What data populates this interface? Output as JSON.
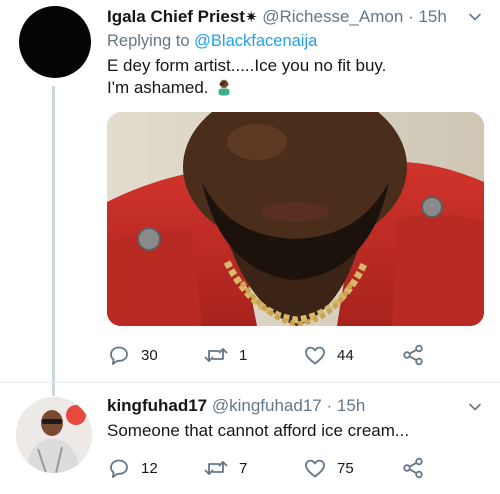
{
  "tweets": [
    {
      "name": "Igala Chief Priest",
      "name_symbol": "✷",
      "handle": "@Richesse_Amon",
      "separator": "·",
      "time": "15h",
      "replying_prefix": "Replying to",
      "replying_to": "@Blackfacenaija",
      "text_line_1": "E dey form artist.....Ice you no fit buy.",
      "text_line_2": "I'm ashamed.",
      "emoji_icon": "man-facepalming-icon",
      "media": "photo of a man in a red jacket with gold chain",
      "replies": "30",
      "retweets": "1",
      "likes": "44"
    },
    {
      "name": "kingfuhad17",
      "handle": "@kingfuhad17",
      "separator": "·",
      "time": "15h",
      "text": "Someone that cannot afford ice cream...",
      "replies": "12",
      "retweets": "7",
      "likes": "75"
    }
  ],
  "icons": {
    "reply": "reply-icon",
    "retweet": "retweet-icon",
    "like": "heart-icon",
    "share": "share-icon",
    "more": "chevron-down-icon"
  },
  "colors": {
    "link": "#1da1f2",
    "secondary_text": "#657786",
    "icon": "#657786",
    "thread_line": "#ccd6dd"
  }
}
